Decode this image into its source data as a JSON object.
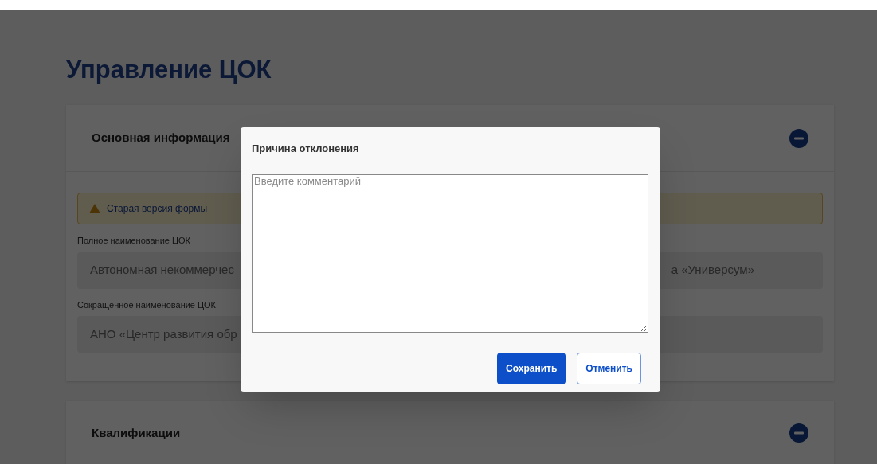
{
  "page": {
    "title": "Управление ЦОК"
  },
  "sections": [
    {
      "title": "Основная информация",
      "expanded": true,
      "alert": {
        "text": "Старая версия формы"
      },
      "fields": [
        {
          "label": "Полное наименование ЦОК",
          "value_visible_start": "Автономная некоммерчес",
          "value_visible_end": "а «Универсум»"
        },
        {
          "label": "Сокращенное наименование ЦОК",
          "value_visible_start": "АНО «Центр развития обр"
        }
      ]
    },
    {
      "title": "Квалификации",
      "expanded": true
    }
  ],
  "modal": {
    "title": "Причина отклонения",
    "placeholder": "Введите комментарий",
    "buttons": [
      {
        "label": "Сохранить",
        "kind": "primary"
      },
      {
        "label": "Отменить",
        "kind": "secondary"
      }
    ]
  }
}
